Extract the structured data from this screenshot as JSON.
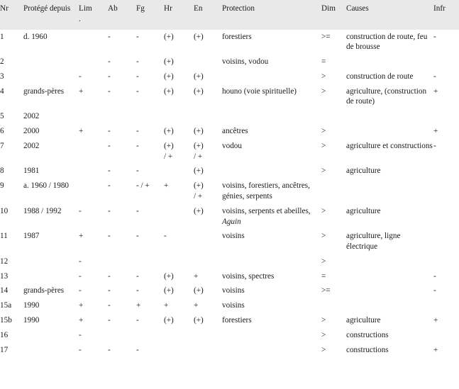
{
  "table": {
    "columns": [
      {
        "key": "nr",
        "label": "Nr"
      },
      {
        "key": "protege",
        "label": "Protégé depuis"
      },
      {
        "key": "lim",
        "label": "Lim",
        "label2": "."
      },
      {
        "key": "ab",
        "label": "Ab"
      },
      {
        "key": "fg",
        "label": "Fg"
      },
      {
        "key": "hr",
        "label": "Hr"
      },
      {
        "key": "en",
        "label": "En"
      },
      {
        "key": "prot",
        "label": "Protection"
      },
      {
        "key": "dim",
        "label": "Dim"
      },
      {
        "key": "causes",
        "label": "Causes"
      },
      {
        "key": "infr",
        "label": "Infr"
      }
    ],
    "header_bg": "#e9e9e9",
    "rows": [
      {
        "nr": "1",
        "protege": "d. 1960",
        "lim": "",
        "ab": "-",
        "fg": "-",
        "hr": "(+)",
        "en": "(+)",
        "prot": "forestiers",
        "dim": ">=",
        "causes": "construction de route, feu de brousse",
        "infr": "-"
      },
      {
        "nr": "2",
        "protege": "",
        "lim": "",
        "ab": "-",
        "fg": "-",
        "hr": "(+)",
        "en": "",
        "prot": "voisins, vodou",
        "dim": "=",
        "causes": "",
        "infr": ""
      },
      {
        "nr": "3",
        "protege": "",
        "lim": "-",
        "ab": "-",
        "fg": "-",
        "hr": "(+)",
        "en": "(+)",
        "prot": "",
        "dim": ">",
        "causes": "construction de route",
        "infr": "-"
      },
      {
        "nr": "4",
        "protege": "grands-pères",
        "lim": "+",
        "ab": "-",
        "fg": "-",
        "hr": "(+)",
        "en": "(+)",
        "prot": "houno (voie spirituelle)",
        "dim": ">",
        "causes": "agriculture, (construction de route)",
        "infr": "+"
      },
      {
        "nr": "5",
        "protege": "2002",
        "lim": "",
        "ab": "",
        "fg": "",
        "hr": "",
        "en": "",
        "prot": "",
        "dim": "",
        "causes": "",
        "infr": ""
      },
      {
        "nr": "6",
        "protege": "2000",
        "lim": "+",
        "ab": "-",
        "fg": "-",
        "hr": "(+)",
        "en": "(+)",
        "prot": "ancêtres",
        "dim": ">",
        "causes": "",
        "infr": "+"
      },
      {
        "nr": "7",
        "protege": "2002",
        "lim": "",
        "ab": "-",
        "fg": "-",
        "hr": "(+)",
        "hr2": "/ +",
        "en": "(+)",
        "en2": "/ +",
        "prot": "vodou",
        "dim": ">",
        "causes": "agriculture et constructions",
        "infr": "-"
      },
      {
        "nr": "8",
        "protege": "1981",
        "lim": "",
        "ab": "-",
        "fg": "-",
        "hr": "",
        "en": "(+)",
        "prot": "",
        "dim": ">",
        "causes": "agriculture",
        "infr": ""
      },
      {
        "nr": "9",
        "protege": "a. 1960 / 1980",
        "lim": "",
        "ab": "-",
        "fg": "- / +",
        "hr": "+",
        "en": "(+)",
        "en2": "/ +",
        "prot": "voisins, forestiers, ancêtres, génies, serpents",
        "dim": "",
        "causes": "",
        "infr": ""
      },
      {
        "nr": "10",
        "protege": "1988 / 1992",
        "lim": "-",
        "ab": "-",
        "fg": "-",
        "hr": "",
        "en": "(+)",
        "prot_pre": "voisins, serpents et abeilles, ",
        "prot_italic": "Aguin",
        "dim": ">",
        "causes": "agriculture",
        "infr": ""
      },
      {
        "nr": "11",
        "protege": "1987",
        "lim": "+",
        "ab": "-",
        "fg": "-",
        "hr": "-",
        "en": "",
        "prot": "voisins",
        "dim": ">",
        "causes": "agriculture, ligne électrique",
        "infr": ""
      },
      {
        "nr": "12",
        "protege": "",
        "lim": "-",
        "ab": "",
        "fg": "",
        "hr": "",
        "en": "",
        "prot": "",
        "dim": ">",
        "causes": "",
        "infr": ""
      },
      {
        "nr": "13",
        "protege": "",
        "lim": "-",
        "ab": "-",
        "fg": "-",
        "hr": "(+)",
        "en": "+",
        "prot": "voisins, spectres",
        "dim": "=",
        "causes": "",
        "infr": "-"
      },
      {
        "nr": "14",
        "protege": "grands-pères",
        "lim": "-",
        "ab": "-",
        "fg": "-",
        "hr": "(+)",
        "en": "(+)",
        "prot": "voisins",
        "dim": ">=",
        "causes": "",
        "infr": "-"
      },
      {
        "nr": "15a",
        "protege": "1990",
        "lim": "+",
        "ab": "-",
        "fg": "+",
        "hr": "+",
        "en": "+",
        "prot": "voisins",
        "dim": "",
        "causes": "",
        "infr": ""
      },
      {
        "nr": "15b",
        "protege": "1990",
        "lim": "+",
        "ab": "-",
        "fg": "-",
        "hr": "(+)",
        "en": "(+)",
        "prot": "forestiers",
        "dim": ">",
        "causes": "agriculture",
        "infr": "+"
      },
      {
        "nr": "16",
        "protege": "",
        "lim": "-",
        "ab": "",
        "fg": "",
        "hr": "",
        "en": "",
        "prot": "",
        "dim": ">",
        "causes": "constructions",
        "infr": ""
      },
      {
        "nr": "17",
        "protege": "",
        "lim": "-",
        "ab": "-",
        "fg": "-",
        "hr": "",
        "en": "",
        "prot": "",
        "dim": ">",
        "causes": "constructions",
        "infr": "+"
      }
    ]
  }
}
